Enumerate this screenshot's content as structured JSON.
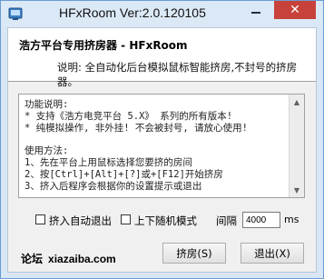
{
  "window": {
    "title": "HFxRoom Ver:2.0.120105",
    "minimize_glyph": "–",
    "close_glyph": "✕"
  },
  "header": {
    "title": "浩方平台专用挤房器 - HFxRoom",
    "description": "说明: 全自动化后台模拟鼠标智能挤房,不封号的挤房器。"
  },
  "info": {
    "text": "功能说明:\n* 支持《浩方电竞平台 5.X》 系列的所有版本!\n* 纯模拟操作, 非外挂! 不会被封号, 请放心使用!\n\n使用方法:\n1、先在平台上用鼠标选择您要挤的房间\n2、按[Ctrl]+[Alt]+[?]或+[F12]开始挤房\n3、挤入后程序会根据你的设置提示或退出"
  },
  "options": {
    "auto_exit_label": "挤入自动退出",
    "auto_exit_checked": false,
    "random_mode_label": "上下随机模式",
    "random_mode_checked": false,
    "interval_label": "间隔",
    "interval_value": "4000",
    "interval_unit": "ms"
  },
  "footer": {
    "forum_label": "论坛",
    "forum_site": "xiazaiba.com",
    "grab_button": "挤房(S)",
    "exit_button": "退出(X)"
  },
  "icons": {
    "app": "app-icon",
    "scroll_up": "scroll-up-arrow-icon",
    "scroll_down": "scroll-down-arrow-icon"
  },
  "colors": {
    "frame": "#d7e7f6",
    "close_button": "#c7423a",
    "client": "#f0f0f0"
  }
}
